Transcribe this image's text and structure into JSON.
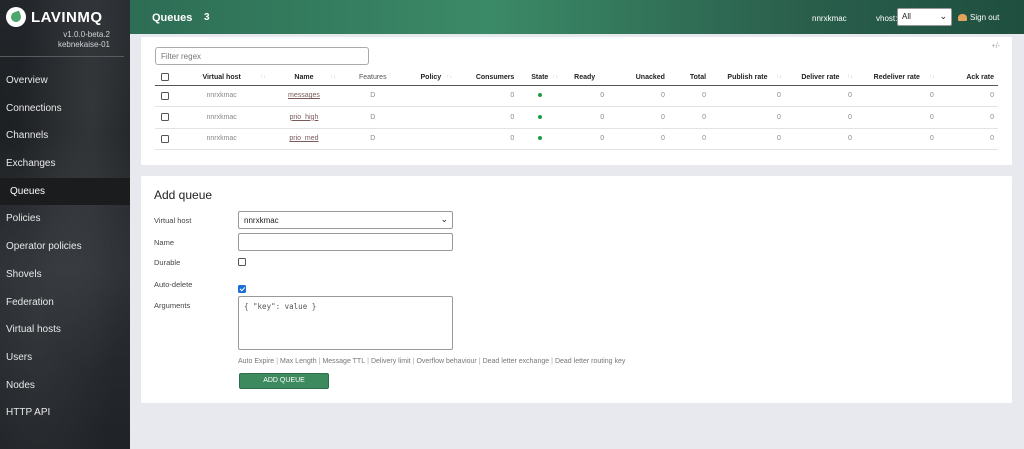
{
  "brand": {
    "name": "LAVINMQ",
    "version": "v1.0.0-beta.2",
    "host": "kebnekaise-01"
  },
  "nav": {
    "items": [
      {
        "label": "Overview"
      },
      {
        "label": "Connections"
      },
      {
        "label": "Channels"
      },
      {
        "label": "Exchanges"
      },
      {
        "label": "Queues",
        "active": true
      },
      {
        "label": "Policies"
      },
      {
        "label": "Operator policies"
      },
      {
        "label": "Shovels"
      },
      {
        "label": "Federation"
      },
      {
        "label": "Virtual hosts"
      },
      {
        "label": "Users"
      },
      {
        "label": "Nodes"
      },
      {
        "label": "HTTP API"
      }
    ]
  },
  "header": {
    "title": "Queues",
    "count": "3",
    "user": "nnrxkmac",
    "vhost_label": "vhost:",
    "vhost_value": "All",
    "signout": "Sign out"
  },
  "queues": {
    "filter_placeholder": "Filter regex",
    "toggle_columns": "+/-",
    "columns": [
      "Virtual host",
      "Name",
      "Features",
      "Policy",
      "Consumers",
      "State",
      "Ready",
      "Unacked",
      "Total",
      "Publish rate",
      "Deliver rate",
      "Redeliver rate",
      "Ack rate"
    ],
    "rows": [
      {
        "vhost": "nnrxkmac",
        "name": "messages",
        "features": "D",
        "policy": "",
        "consumers": "0",
        "ready": "0",
        "unacked": "0",
        "total": "0",
        "publish": "0",
        "deliver": "0",
        "redeliver": "0",
        "ack": "0"
      },
      {
        "vhost": "nnrxkmac",
        "name": "prio_high",
        "features": "D",
        "policy": "",
        "consumers": "0",
        "ready": "0",
        "unacked": "0",
        "total": "0",
        "publish": "0",
        "deliver": "0",
        "redeliver": "0",
        "ack": "0"
      },
      {
        "vhost": "nnrxkmac",
        "name": "prio_med",
        "features": "D",
        "policy": "",
        "consumers": "0",
        "ready": "0",
        "unacked": "0",
        "total": "0",
        "publish": "0",
        "deliver": "0",
        "redeliver": "0",
        "ack": "0"
      }
    ]
  },
  "add_queue": {
    "title": "Add queue",
    "vhost_label": "Virtual host",
    "vhost_value": "nnrxkmac",
    "name_label": "Name",
    "durable_label": "Durable",
    "autodelete_label": "Auto-delete",
    "arguments_label": "Arguments",
    "arguments_placeholder": "{ \"key\": value }",
    "argument_links": [
      "Auto Expire",
      "Max Length",
      "Message TTL",
      "Delivery limit",
      "Overflow behaviour",
      "Dead letter exchange",
      "Dead letter routing key"
    ],
    "submit_label": "ADD QUEUE"
  },
  "colors": {
    "accent": "#3d8a5e",
    "header": "#2d6d55",
    "state_running": "#1e9e42"
  },
  "icons": {
    "logo": "rabbit-leaf-icon",
    "signout": "signout-icon",
    "dropdown": "chevron-down-icon"
  }
}
